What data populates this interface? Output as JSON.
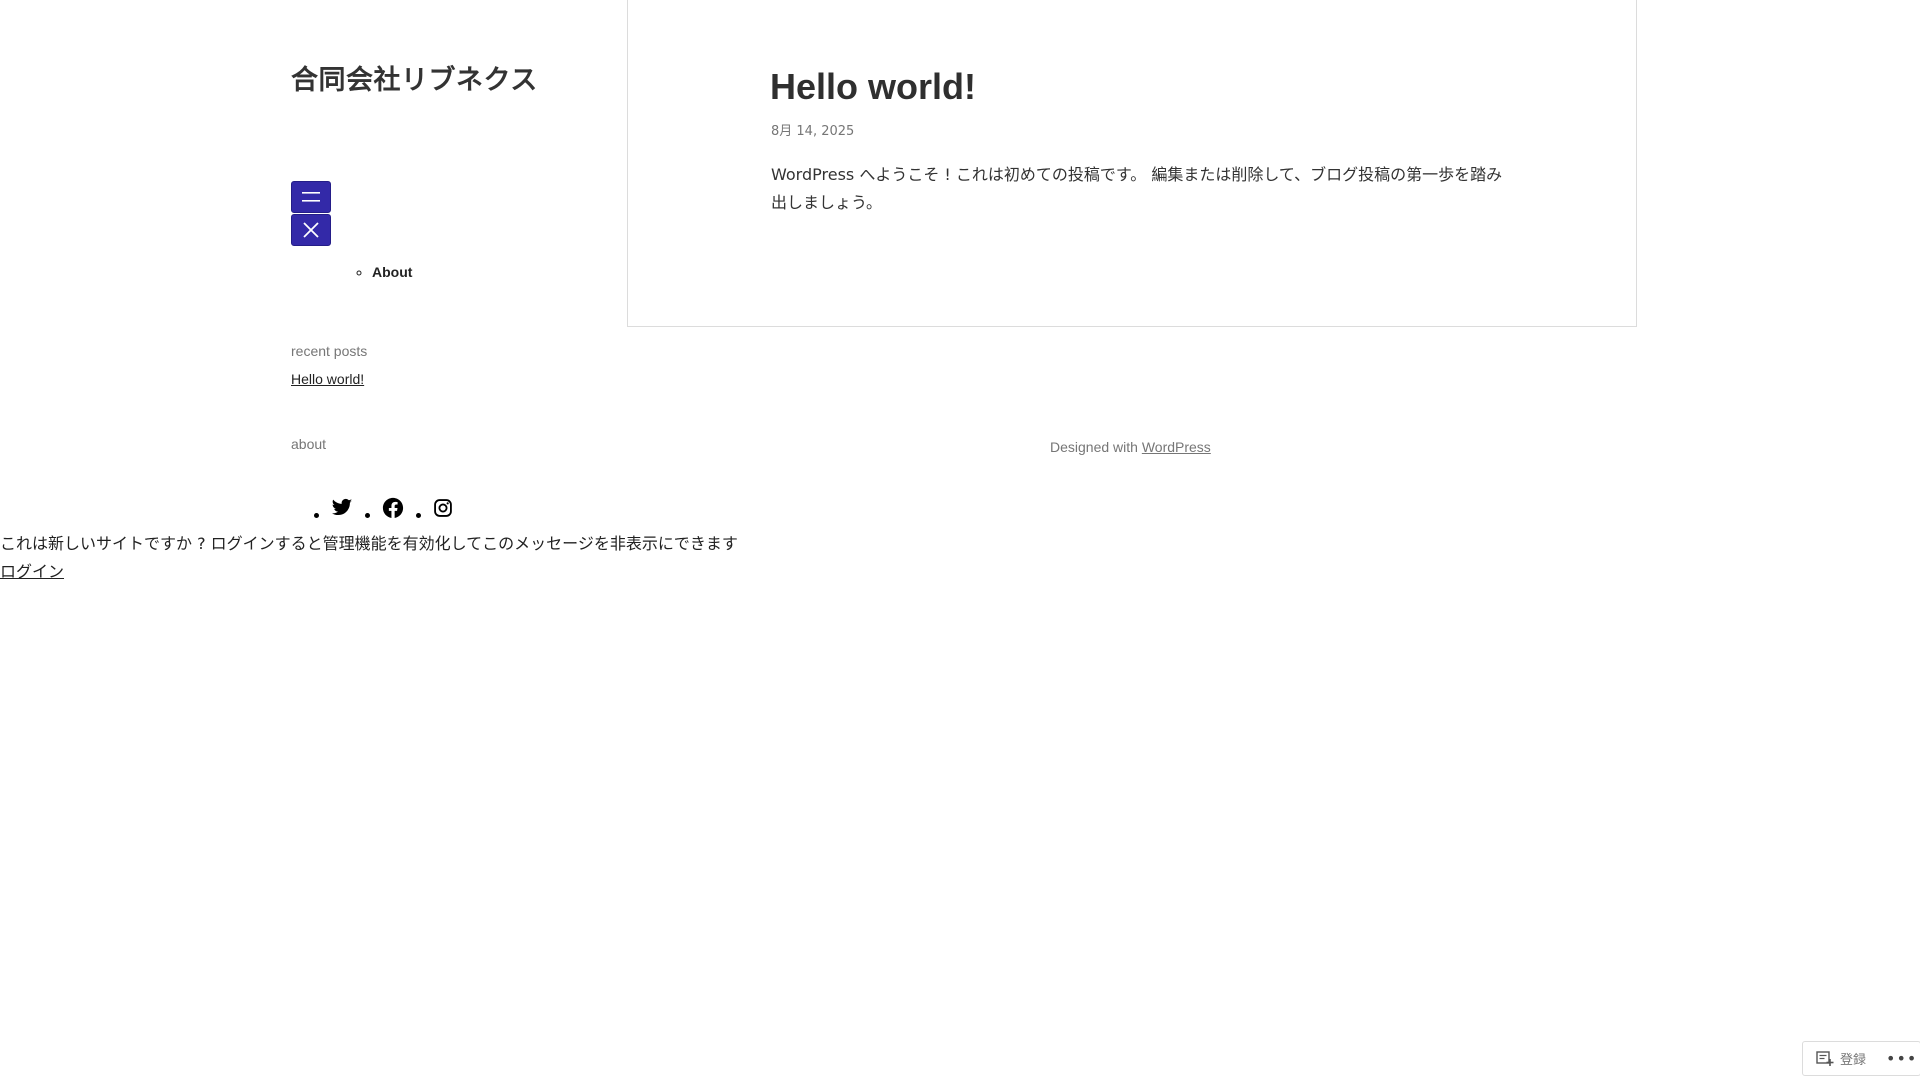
{
  "site": {
    "title": "合同会社リブネクス"
  },
  "nav": {
    "open_icon": "hamburger-icon",
    "close_icon": "close-icon",
    "items": [
      {
        "label": "About"
      }
    ]
  },
  "sidebar": {
    "recent_posts_title": "recent posts",
    "recent_posts": [
      {
        "label": "Hello world!"
      }
    ],
    "about_title": "about",
    "social_icons": [
      "twitter-icon",
      "facebook-icon",
      "instagram-icon"
    ]
  },
  "post": {
    "title": "Hello world!",
    "date": "8月 14, 2025",
    "body": "WordPress へようこそ ! これは初めての投稿です。 編集または削除して、ブログ投稿の第一歩を踏み出しましょう。"
  },
  "footer": {
    "prefix": "Designed with",
    "link_label": "WordPress"
  },
  "notice": {
    "message": "これは新しいサイトですか ? ログインすると管理機能を有効化してこのメッセージを非表示にできます",
    "login_label": "ログイン"
  },
  "admin_bar": {
    "register_label": "登録",
    "more_label": "•••"
  },
  "colors": {
    "accent": "#3329a8",
    "muted_text": "#767676",
    "border": "#dcdcdc"
  }
}
